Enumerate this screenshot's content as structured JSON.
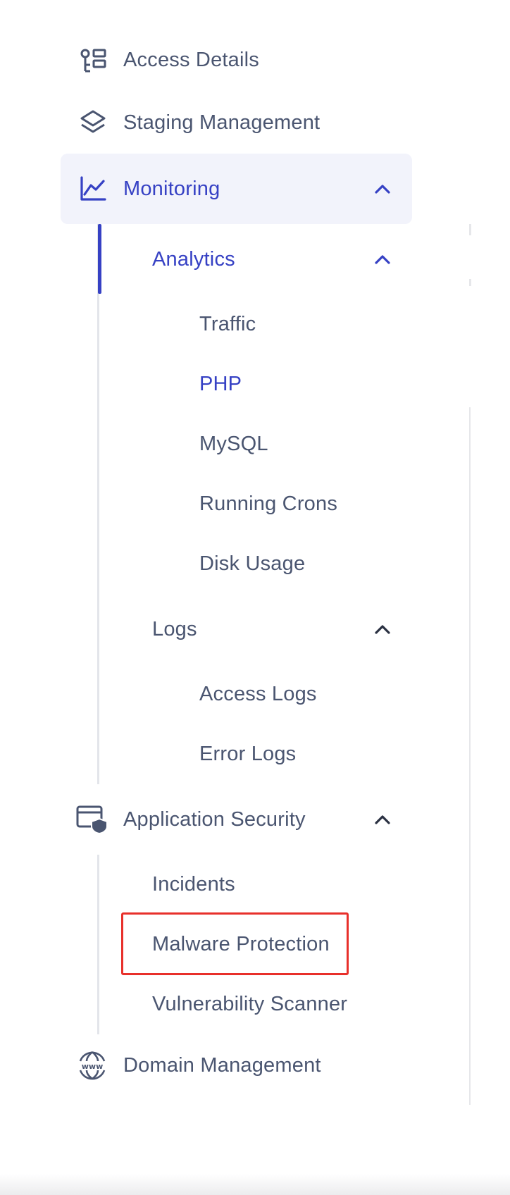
{
  "colors": {
    "accent": "#3641c4",
    "text": "#4a5570",
    "highlight_bg": "#f2f3fb",
    "annotation": "#e8302b"
  },
  "nav": {
    "access_details": {
      "label": "Access Details",
      "icon": "access-details-icon"
    },
    "staging": {
      "label": "Staging Management",
      "icon": "layers-icon"
    },
    "monitoring": {
      "label": "Monitoring",
      "icon": "line-chart-icon",
      "expanded": true,
      "analytics": {
        "label": "Analytics",
        "expanded": true,
        "items": [
          "Traffic",
          "PHP",
          "MySQL",
          "Running Crons",
          "Disk Usage"
        ],
        "active_item": "PHP"
      },
      "logs": {
        "label": "Logs",
        "expanded": true,
        "items": [
          "Access Logs",
          "Error Logs"
        ]
      }
    },
    "app_security": {
      "label": "Application Security",
      "icon": "app-shield-icon",
      "expanded": true,
      "items": [
        "Incidents",
        "Malware Protection",
        "Vulnerability Scanner"
      ],
      "highlighted_item": "Malware Protection"
    },
    "domain": {
      "label": "Domain Management",
      "icon": "www-globe-icon"
    }
  }
}
